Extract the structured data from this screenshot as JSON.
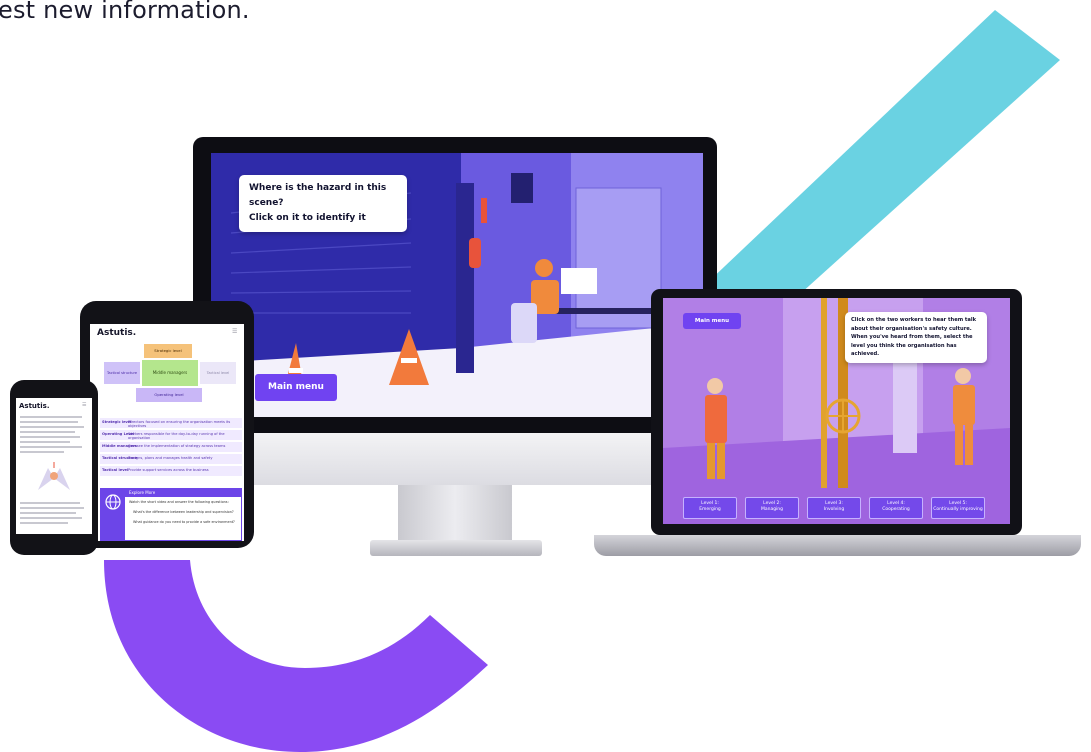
{
  "intro_text": "est new information.",
  "colors": {
    "brand_purple": "#7043f1",
    "brand_teal": "#6ad2e2",
    "scene_navy": "#2e2aa8"
  },
  "monitor": {
    "prompt_line1": "Where is the hazard in this scene?",
    "prompt_line2": "Click on it to identify it",
    "main_menu": "Main menu"
  },
  "laptop": {
    "main_menu": "Main menu",
    "prompt": "Click on the two workers to hear them talk about their organisation's safety culture. When you've heard from them, select the level you think the organisation has achieved.",
    "levels": [
      {
        "num": "Level 1:",
        "name": "Emerging"
      },
      {
        "num": "Level 2:",
        "name": "Managing"
      },
      {
        "num": "Level 3:",
        "name": "Involving"
      },
      {
        "num": "Level 4:",
        "name": "Cooperating"
      },
      {
        "num": "Level 5:",
        "name": "Continually improving"
      }
    ]
  },
  "tablet": {
    "logo": "Astutis.",
    "pyramid": {
      "top": "Strategic level",
      "middle": "Middle managers",
      "bottom": "Operating level",
      "left": "Tactical structure",
      "right": "Tactical level"
    },
    "table": [
      {
        "label": "Strategic level",
        "desc": "Directors focused on ensuring the organisation meets its objectives"
      },
      {
        "label": "Operating Level",
        "desc": "Workers responsible for the day-to-day running of the organisation"
      },
      {
        "label": "Middle managers",
        "desc": "Oversee the implementation of strategy across teams"
      },
      {
        "label": "Tactical structure",
        "desc": "Designs, plans and manages health and safety"
      },
      {
        "label": "Tactical level",
        "desc": "Provide support services across the business"
      }
    ],
    "explore_title": "Explore More",
    "explore_intro": "Watch the short video and answer the following questions:",
    "explore_q1": "What's the difference between leadership and supervision?",
    "explore_q2": "What guidance do you need to provide a safe environment?"
  },
  "phone": {
    "logo": "Astutis."
  }
}
